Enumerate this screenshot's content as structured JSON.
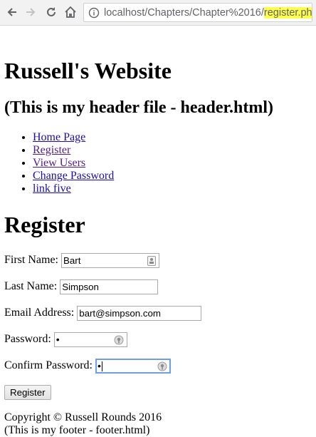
{
  "browser": {
    "url_base": "localhost/Chapters/Chapter%2016/",
    "url_file": "register.php"
  },
  "header": {
    "site_title": "Russell's Website",
    "note": "(This is my header file - header.html)"
  },
  "nav": {
    "items": [
      {
        "label": "Home Page"
      },
      {
        "label": "Register"
      },
      {
        "label": "View Users"
      },
      {
        "label": "Change Password"
      },
      {
        "label": "link five"
      }
    ]
  },
  "main": {
    "title": "Register",
    "form": {
      "first_name_label": "First Name:",
      "first_name_value": "Bart",
      "last_name_label": "Last Name:",
      "last_name_value": "Simpson",
      "email_label": "Email Address:",
      "email_value": "bart@simpson.com",
      "password_label": "Password:",
      "password_value": "•",
      "confirm_label": "Confirm Password:",
      "confirm_value": "•",
      "submit_label": "Register"
    }
  },
  "footer": {
    "copyright": "Copyright © Russell Rounds 2016",
    "note": "(This is my footer - footer.html)"
  },
  "colors": {
    "link": "#1a0dab",
    "visited_link": "#551a8b",
    "url_highlight": "#ffff4d",
    "focus_border": "#6d9fe8"
  }
}
